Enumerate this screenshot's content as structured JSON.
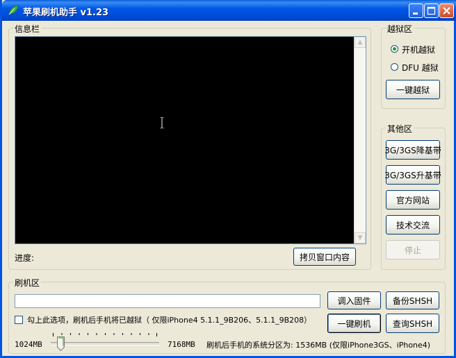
{
  "window": {
    "title": "苹果刷机助手 v1.23"
  },
  "info_group": {
    "label": "信息栏",
    "progress_label": "进度:",
    "copy_button": "拷贝窗口内容"
  },
  "jailbreak_group": {
    "label": "越狱区",
    "options": [
      {
        "label": "开机越狱",
        "selected": true
      },
      {
        "label": "DFU 越狱",
        "selected": false
      }
    ],
    "button": "一键越狱"
  },
  "other_group": {
    "label": "其他区",
    "buttons": [
      {
        "label": "3G/3GS降基带",
        "enabled": true
      },
      {
        "label": "3G/3GS升基带",
        "enabled": true
      },
      {
        "label": "官方网站",
        "enabled": true
      },
      {
        "label": "技术交流",
        "enabled": true
      },
      {
        "label": "停止",
        "enabled": false
      }
    ]
  },
  "flash_group": {
    "label": "刷机区",
    "load_firmware": "调入固件",
    "backup_shsh": "备份SHSH",
    "one_click_flash": "一键刷机",
    "query_shsh": "查询SHSH",
    "checkbox_label": "勾上此选项，刷机后手机将已越狱（ 仅限iPhone4 5.1.1_9B206、5.1.1_9B208）",
    "checkbox_checked": false,
    "slider_min": "1024MB",
    "slider_max": "7168MB",
    "slider_value_fraction": 0.05,
    "partition_text": "刷机后手机的系统分区为: 1536MB (仅限iPhone3GS、iPhone4)"
  },
  "colors": {
    "titlebar": "#0054e3",
    "info_bg": "#000000",
    "window_bg": "#ece9d8"
  }
}
